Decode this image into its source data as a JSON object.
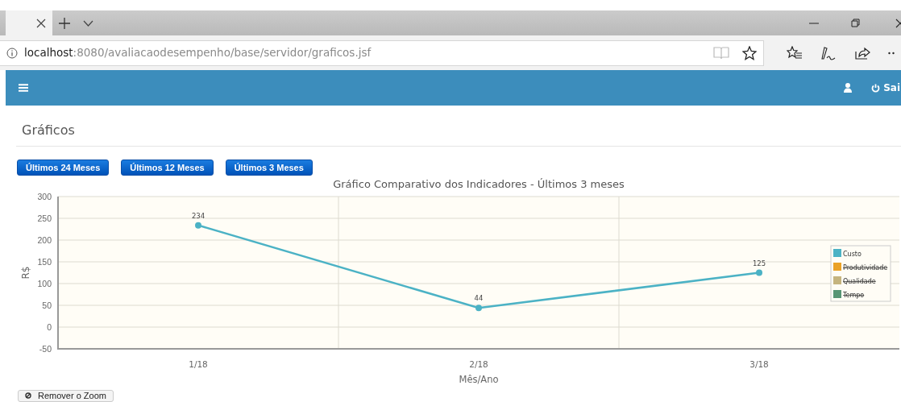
{
  "browser": {
    "url_host": "localhost",
    "url_path": ":8080/avaliacaodesempenho/base/servidor/graficos.jsf"
  },
  "navbar": {
    "logout_label": "Sai"
  },
  "page": {
    "title": "Gráficos"
  },
  "period_buttons": [
    {
      "label": "Últimos 24 Meses"
    },
    {
      "label": "Últimos 12 Meses"
    },
    {
      "label": "Últimos 3 Meses"
    }
  ],
  "chart_data": {
    "type": "line",
    "title": "Gráfico Comparativo dos Indicadores - Últimos 3 meses",
    "xlabel": "Mês/Ano",
    "ylabel": "R$",
    "categories": [
      "1/18",
      "2/18",
      "3/18"
    ],
    "ylim": [
      -50,
      300
    ],
    "yticks": [
      -50,
      0,
      50,
      100,
      150,
      200,
      250,
      300
    ],
    "data_labels": true,
    "grid": true,
    "series": [
      {
        "name": "Custo",
        "color": "#4bb2c5",
        "marker": "circle",
        "values": [
          234,
          44,
          125
        ]
      },
      {
        "name": "Produtividade",
        "color": "#eaa228",
        "values": [
          null,
          null,
          null
        ]
      },
      {
        "name": "Qualidade",
        "color": "#c5b47f",
        "values": [
          null,
          null,
          null
        ]
      },
      {
        "name": "Tempo",
        "color": "#579575",
        "values": [
          null,
          null,
          null
        ]
      }
    ]
  },
  "legend": [
    {
      "hidden": false
    },
    {
      "hidden": true
    },
    {
      "hidden": true
    },
    {
      "hidden": true
    }
  ],
  "zoom_button": {
    "label": "Remover o Zoom"
  }
}
